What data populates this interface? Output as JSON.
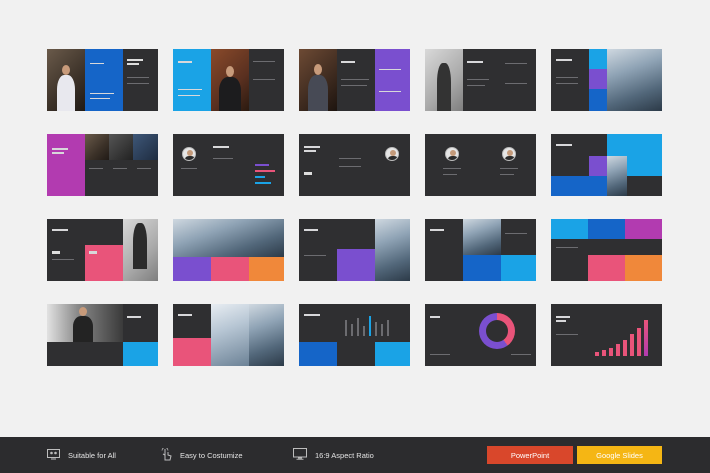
{
  "footer": {
    "features": [
      {
        "label": "Suitable for All",
        "icon": "people-monitor-icon"
      },
      {
        "label": "Easy to Costumize",
        "icon": "touch-hand-icon"
      },
      {
        "label": "16:9 Aspect Ratio",
        "icon": "monitor-icon"
      }
    ],
    "buttons": [
      {
        "label": "PowerPoint",
        "color": "#d9472b"
      },
      {
        "label": "Google Slides",
        "color": "#f5b614"
      }
    ]
  },
  "palette": {
    "dark": "#2f2f31",
    "blue": "#1565c8",
    "cyan": "#1aa3e6",
    "purple": "#7a4fcf",
    "magenta": "#b23bb0",
    "pink": "#e9547a",
    "orange": "#f0883a"
  }
}
